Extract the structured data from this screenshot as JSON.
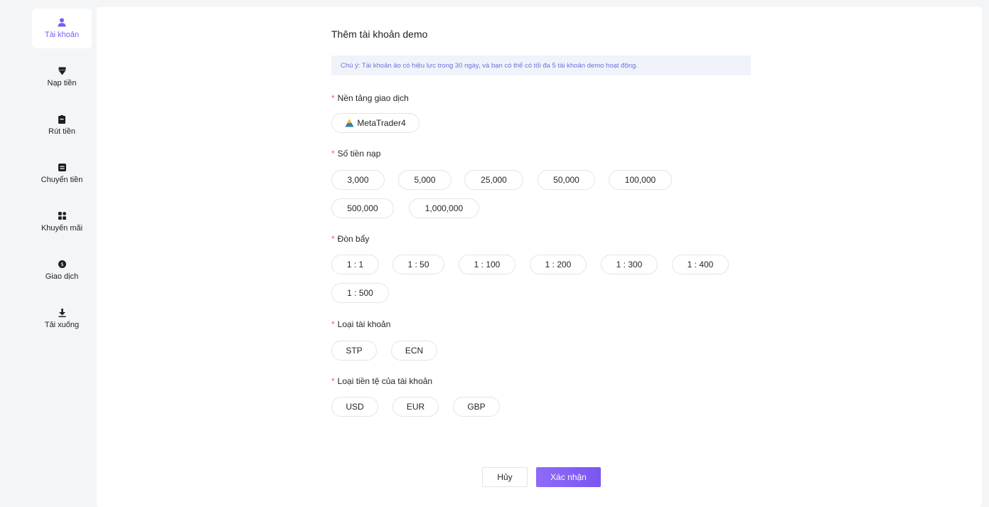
{
  "sidebar": {
    "items": [
      {
        "label": "Tài khoản",
        "icon": "user-icon",
        "active": true
      },
      {
        "label": "Nạp tiền",
        "icon": "deposit-icon",
        "active": false
      },
      {
        "label": "Rút tiền",
        "icon": "withdraw-icon",
        "active": false
      },
      {
        "label": "Chuyển tiền",
        "icon": "transfer-icon",
        "active": false
      },
      {
        "label": "Khuyến mãi",
        "icon": "promotion-icon",
        "active": false
      },
      {
        "label": "Giao dịch",
        "icon": "trade-icon",
        "active": false
      },
      {
        "label": "Tải xuống",
        "icon": "download-icon",
        "active": false
      }
    ]
  },
  "form": {
    "title": "Thêm tài khoản demo",
    "notice": "Chú ý:  Tài khoản ảo có hiệu lực trong 30 ngày, và bạn có thể có tối đa 5 tài khoản demo hoạt động.",
    "platform": {
      "label": "Nền tảng giao dịch",
      "options": [
        "MetaTrader4"
      ]
    },
    "deposit": {
      "label": "Số tiền nạp",
      "options": [
        "3,000",
        "5,000",
        "25,000",
        "50,000",
        "100,000",
        "500,000",
        "1,000,000"
      ]
    },
    "leverage": {
      "label": "Đòn bẩy",
      "options": [
        "1 : 1",
        "1 : 50",
        "1 : 100",
        "1 : 200",
        "1 : 300",
        "1 : 400",
        "1 : 500"
      ]
    },
    "account_type": {
      "label": "Loại tài khoản",
      "options": [
        "STP",
        "ECN"
      ]
    },
    "currency": {
      "label": "Loại tiền tệ của tài khoản",
      "options": [
        "USD",
        "EUR",
        "GBP"
      ]
    },
    "required_mark": "*",
    "cancel_label": "Hủy",
    "confirm_label": "Xác nhận"
  },
  "colors": {
    "accent": "#7b5cf5",
    "required": "#ff5a5a",
    "notice_text": "#6a74d8",
    "notice_bg": "#f1f3fb"
  }
}
